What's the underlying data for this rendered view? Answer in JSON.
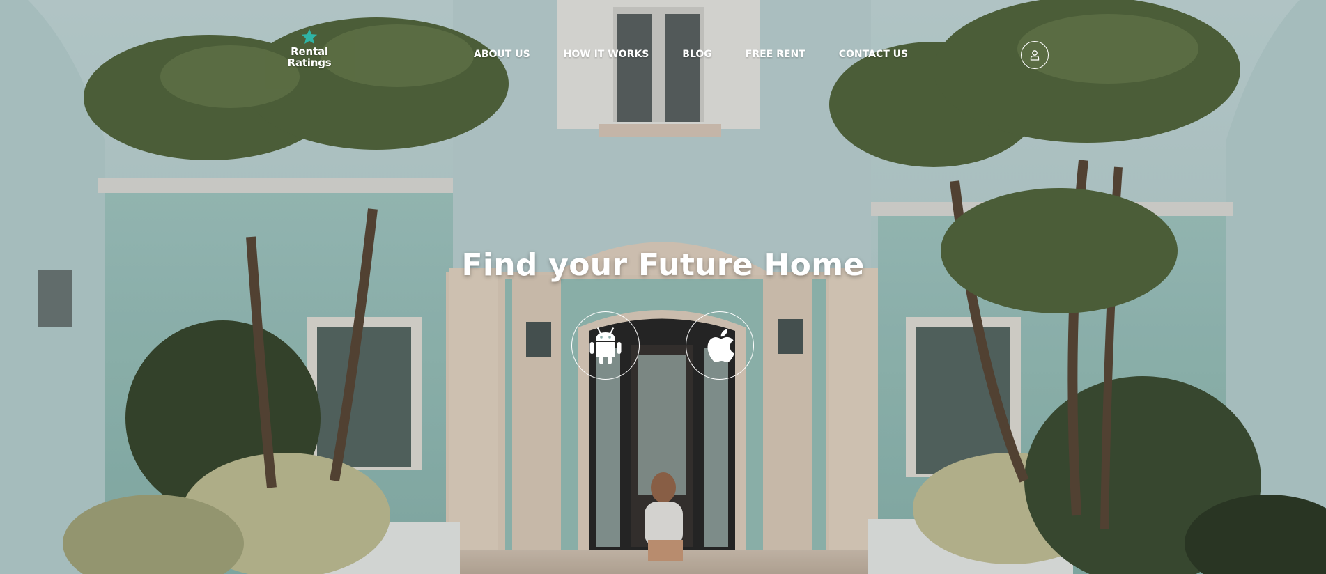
{
  "brand": {
    "name_line1": "Rental",
    "name_line2": "Ratings",
    "accent_color": "#2fb4a6",
    "logo_icon": "star-icon"
  },
  "nav": {
    "items": [
      {
        "label": "ABOUT US"
      },
      {
        "label": "HOW IT WORKS"
      },
      {
        "label": "BLOG"
      },
      {
        "label": "FREE RENT"
      },
      {
        "label": "CONTACT US"
      }
    ],
    "user_icon": "user-icon"
  },
  "hero": {
    "headline": "Find your Future Home",
    "background_subject": "pastel teal villa with palm trees and a woman seated on the entrance steps",
    "downloads": [
      {
        "icon": "android-icon"
      },
      {
        "icon": "apple-icon"
      }
    ]
  },
  "colors": {
    "wall": "#b6d3d4",
    "trim": "#e6d6c6",
    "palm": "#4a5c3a",
    "text": "#ffffff"
  }
}
